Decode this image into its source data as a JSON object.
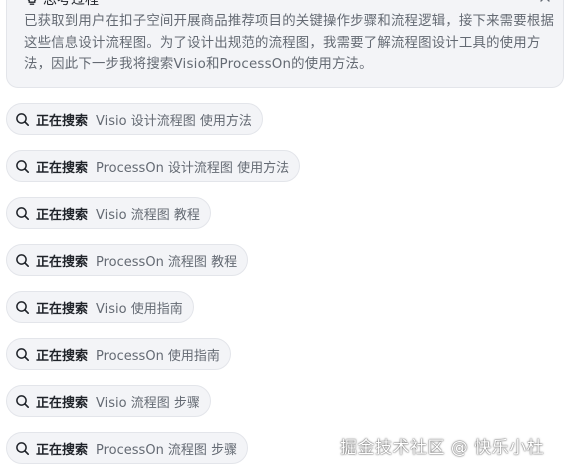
{
  "thinking": {
    "title": "思考过程",
    "icon": "lightbulb-icon",
    "collapse_icon": "chevron-up-icon",
    "body": "已获取到用户在扣子空间开展商品推荐项目的关键操作步骤和流程逻辑，接下来需要根据这些信息设计流程图。为了设计出规范的流程图，我需要了解流程图设计工具的使用方法，因此下一步我将搜索Visio和ProcessOn的使用方法。"
  },
  "searches": [
    {
      "status": "正在搜索",
      "query": "Visio 设计流程图 使用方法"
    },
    {
      "status": "正在搜索",
      "query": "ProcessOn 设计流程图 使用方法"
    },
    {
      "status": "正在搜索",
      "query": "Visio 流程图 教程"
    },
    {
      "status": "正在搜索",
      "query": "ProcessOn 流程图 教程"
    },
    {
      "status": "正在搜索",
      "query": "Visio 使用指南"
    },
    {
      "status": "正在搜索",
      "query": "ProcessOn 使用指南"
    },
    {
      "status": "正在搜索",
      "query": "Visio 流程图 步骤"
    },
    {
      "status": "正在搜索",
      "query": "ProcessOn 流程图 步骤"
    }
  ],
  "watermark": "掘金技术社区 @ 快乐小杜"
}
